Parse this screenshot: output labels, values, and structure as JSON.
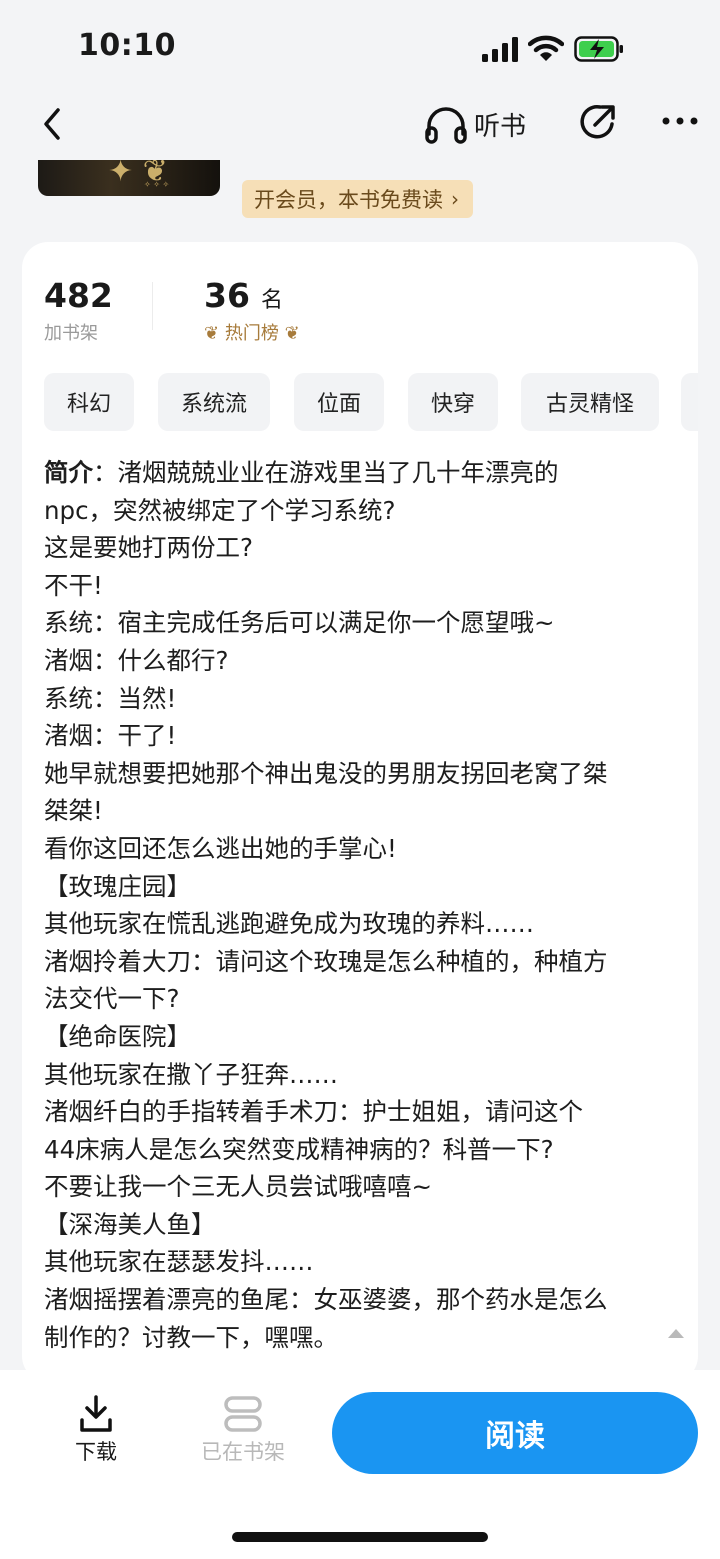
{
  "status_bar": {
    "time": "10:10"
  },
  "nav": {
    "listen_label": "听书"
  },
  "promo": {
    "vip_label": "开会员，本书免费读"
  },
  "stats": {
    "shelf_count": "482",
    "shelf_label": "加书架",
    "rank_num": "36",
    "rank_unit": "名",
    "rank_label": "热门榜"
  },
  "tags": [
    "科幻",
    "系统流",
    "位面",
    "快穿",
    "古灵精怪"
  ],
  "intro": {
    "label": "简介",
    "first_line": "：渚烟兢兢业业在游戏里当了几十年漂亮的",
    "lines": [
      "npc，突然被绑定了个学习系统?",
      "这是要她打两份工?",
      "不干!",
      "系统：宿主完成任务后可以满足你一个愿望哦~",
      "渚烟：什么都行?",
      "系统：当然!",
      "渚烟：干了!",
      "她早就想要把她那个神出鬼没的男朋友拐回老窝了桀",
      "桀桀!",
      "看你这回还怎么逃出她的手掌心!",
      "【玫瑰庄园】",
      "其他玩家在慌乱逃跑避免成为玫瑰的养料……",
      "渚烟拎着大刀：请问这个玫瑰是怎么种植的，种植方",
      "法交代一下?",
      "【绝命医院】",
      "其他玩家在撒丫子狂奔……",
      "渚烟纤白的手指转着手术刀：护士姐姐，请问这个",
      "44床病人是怎么突然变成精神病的？科普一下?",
      "不要让我一个三无人员尝试哦嘻嘻~",
      "【深海美人鱼】",
      "其他玩家在瑟瑟发抖……",
      "渚烟摇摆着漂亮的鱼尾：女巫婆婆，那个药水是怎么",
      "制作的？讨教一下，嘿嘿。"
    ]
  },
  "bottom": {
    "download_label": "下载",
    "shelf_label": "已在书架",
    "read_label": "阅读"
  },
  "colors": {
    "accent": "#1a95f2",
    "vip_bg": "#f6dfb7",
    "rank": "#a77b3b"
  }
}
